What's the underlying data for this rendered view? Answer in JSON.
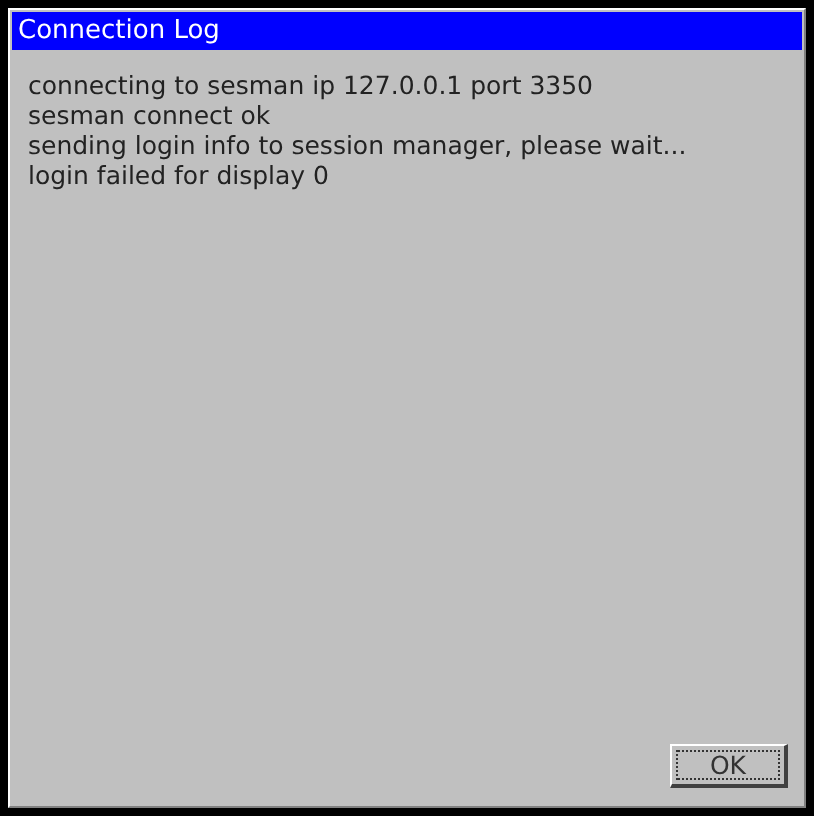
{
  "window": {
    "title": "Connection Log"
  },
  "log_lines": [
    "connecting to sesman ip 127.0.0.1 port 3350",
    "sesman connect ok",
    "sending login info to session manager, please wait...",
    "login failed for display 0"
  ],
  "buttons": [
    {
      "label": "OK",
      "focused": true
    }
  ]
}
